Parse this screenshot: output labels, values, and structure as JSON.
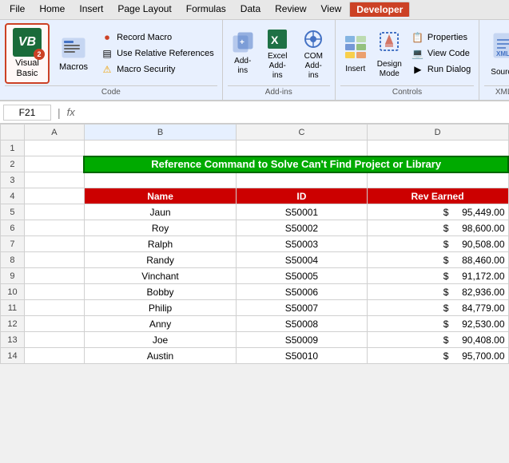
{
  "menu": {
    "items": [
      "File",
      "Home",
      "Insert",
      "Page Layout",
      "Formulas",
      "Data",
      "Review",
      "View",
      "Developer"
    ],
    "active": "Developer"
  },
  "ribbon": {
    "groups": {
      "code": {
        "label": "Code",
        "vb_button": {
          "label": "Visual\nBasic",
          "badge": "2"
        },
        "macros_label": "Macros",
        "small_buttons": [
          {
            "label": "Record Macro",
            "icon": "⏺"
          },
          {
            "label": "Use Relative References",
            "icon": "▤"
          },
          {
            "label": "Macro Security",
            "icon": "⚠"
          }
        ]
      },
      "addins": {
        "label": "Add-ins",
        "buttons": [
          {
            "label": "Add-\nins",
            "icon": "🔧"
          },
          {
            "label": "Excel\nAdd-ins",
            "icon": "📊"
          },
          {
            "label": "COM\nAdd-ins",
            "icon": "🔩"
          }
        ]
      },
      "controls": {
        "label": "Controls",
        "insert_label": "Insert",
        "design_label": "Design\nMode",
        "small_buttons": [
          {
            "label": "Properties"
          },
          {
            "label": "View Code"
          },
          {
            "label": "Run Dialog"
          }
        ]
      },
      "source": {
        "label": "Source",
        "button_label": "Source"
      }
    }
  },
  "formula_bar": {
    "cell_ref": "F21",
    "fx_label": "fx"
  },
  "columns": [
    "",
    "A",
    "B",
    "C",
    "D"
  ],
  "rows": [
    {
      "num": "1",
      "cells": [
        "",
        "",
        "",
        ""
      ]
    },
    {
      "num": "2",
      "cells": [
        "",
        "Reference Command to Solve Can't Find Project or Library",
        "",
        ""
      ],
      "title": true
    },
    {
      "num": "3",
      "cells": [
        "",
        "",
        "",
        ""
      ]
    },
    {
      "num": "4",
      "cells": [
        "",
        "Name",
        "ID",
        "Rev Earned"
      ],
      "header": true
    },
    {
      "num": "5",
      "cells": [
        "",
        "Jaun",
        "S50001",
        "$",
        "95,449.00"
      ]
    },
    {
      "num": "6",
      "cells": [
        "",
        "Roy",
        "S50002",
        "$",
        "98,600.00"
      ]
    },
    {
      "num": "7",
      "cells": [
        "",
        "Ralph",
        "S50003",
        "$",
        "90,508.00"
      ]
    },
    {
      "num": "8",
      "cells": [
        "",
        "Randy",
        "S50004",
        "$",
        "88,460.00"
      ]
    },
    {
      "num": "9",
      "cells": [
        "",
        "Vinchant",
        "S50005",
        "$",
        "91,172.00"
      ]
    },
    {
      "num": "10",
      "cells": [
        "",
        "Bobby",
        "S50006",
        "$",
        "82,936.00"
      ]
    },
    {
      "num": "11",
      "cells": [
        "",
        "Philip",
        "S50007",
        "$",
        "84,779.00"
      ]
    },
    {
      "num": "12",
      "cells": [
        "",
        "Anny",
        "S50008",
        "$",
        "92,530.00"
      ]
    },
    {
      "num": "13",
      "cells": [
        "",
        "Joe",
        "S50009",
        "$",
        "90,408.00"
      ]
    },
    {
      "num": "14",
      "cells": [
        "",
        "Austin",
        "S50010",
        "$",
        "95,700.00"
      ]
    }
  ]
}
